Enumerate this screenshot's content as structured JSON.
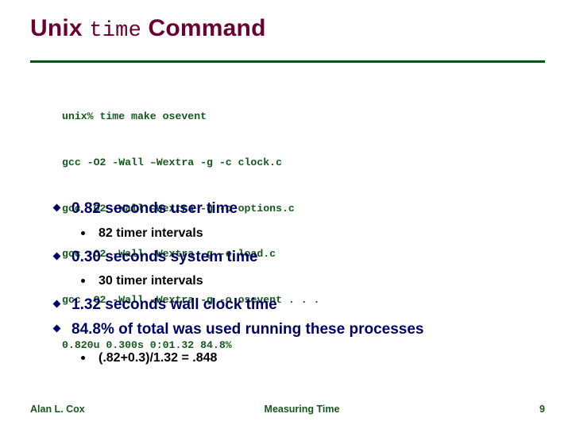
{
  "slide": {
    "title": {
      "part1": "Unix ",
      "mono": "time",
      "part2": " Command"
    },
    "accent_colors": {
      "title": "#690033",
      "rule": "#0d5016",
      "code": "#14591c",
      "bullet_level1": "#000066",
      "bullet_level2": "#000000",
      "footer": "#14591c"
    },
    "code_block": {
      "lines": [
        "unix% time make osevent",
        "gcc -O2 -Wall –Wextra -g -c clock.c",
        "gcc -O2 -Wall –Wextra -g -c options.c",
        "gcc -O2 -Wall –Wextra -g -c load.c",
        "gcc -O2 -Wall –Wextra -g -o osevent . . .",
        "0.820u 0.300s 0:01.32 84.8%"
      ]
    },
    "bullets": [
      {
        "level": 1,
        "text": "0.82 seconds user time"
      },
      {
        "level": 2,
        "text": "82 timer intervals"
      },
      {
        "level": 1,
        "text": "0.30 seconds system time"
      },
      {
        "level": 2,
        "text": "30 timer intervals"
      },
      {
        "level": 1,
        "text": "1.32 seconds wall clock time"
      },
      {
        "level": 1,
        "text": "84.8% of total was used running these processes"
      },
      {
        "level": 2,
        "text": "(.82+0.3)/1.32 = .848"
      }
    ],
    "footer": {
      "author": "Alan L. Cox",
      "subject": "Measuring Time",
      "page": "9"
    }
  }
}
